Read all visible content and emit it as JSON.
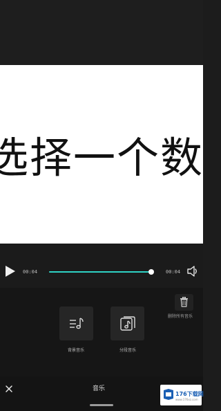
{
  "preview": {
    "text": "选择一个数"
  },
  "player": {
    "current_time": "00:04",
    "total_time": "00:04",
    "progress": 1.0,
    "accent_color": "#2fd4c6",
    "play_icon": "play-icon",
    "volume_icon": "volume-icon"
  },
  "actions": {
    "delete_icon": "trash-icon",
    "delete_label": "删除所有音乐",
    "tiles": [
      {
        "label": "背景音乐",
        "icon": "music-note-icon"
      },
      {
        "label": "分段音乐",
        "icon": "music-stack-icon"
      }
    ]
  },
  "bottom_bar": {
    "close_icon": "close-icon",
    "title": "音乐"
  },
  "watermark": {
    "text": "176下载网",
    "sub": "www.176xz.com"
  }
}
